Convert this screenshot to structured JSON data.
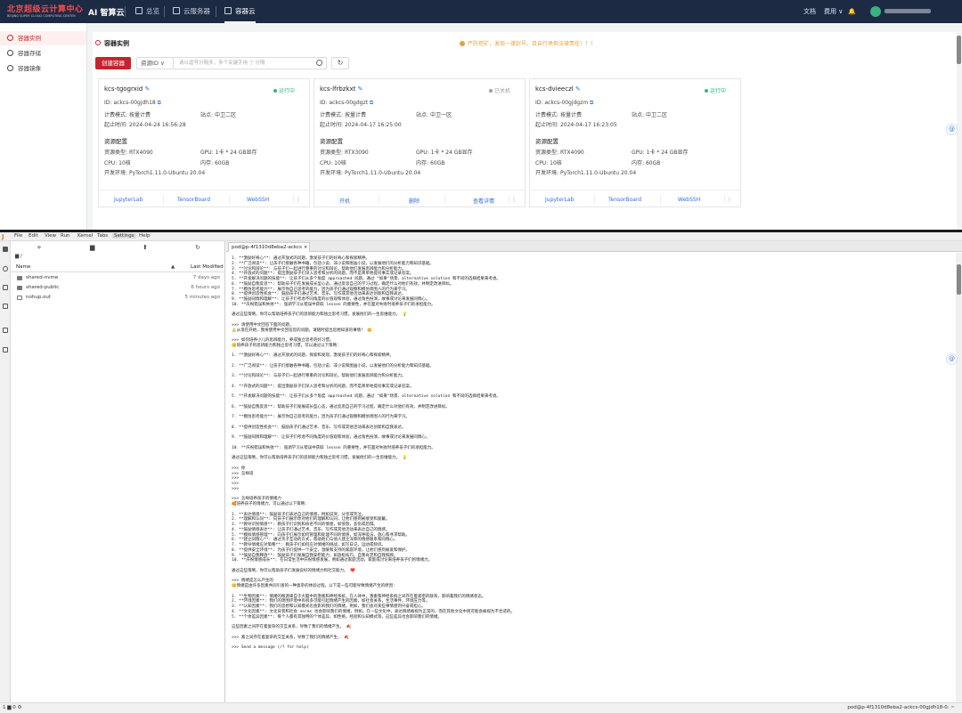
{
  "topbar": {
    "logo_main": "北京超级云计算中心",
    "logo_sub": "BEIJING SUPER CLOUD COMPUTING CENTER",
    "brand": "AI 智算云",
    "nav": [
      {
        "label": "总览",
        "icon": "home-icon"
      },
      {
        "label": "云服务器",
        "icon": "server-icon"
      },
      {
        "label": "容器云",
        "icon": "container-icon"
      }
    ],
    "right": {
      "docs": "文档",
      "billing": "费用",
      "billing_arrow": "∨",
      "bell": "🔔"
    }
  },
  "sidebar": {
    "items": [
      {
        "label": "容器实例",
        "icon": "container-icon"
      },
      {
        "label": "容器存储",
        "icon": "storage-icon"
      },
      {
        "label": "容器镜像",
        "icon": "image-icon"
      }
    ]
  },
  "main": {
    "title": "容器实例",
    "warning": "严防挖矿，发现一律封号，且自行承担法律责任！！！",
    "create_button": "创建容器",
    "select": "资源ID",
    "select_arrow": "∨",
    "search_placeholder": "请以逗号分隔多，多个关键字用 '|' 分隔",
    "refresh": "↻",
    "cards": [
      {
        "name": "kcs-tgogrxid",
        "status": "运行中",
        "status_color": "#36b37e",
        "id_label": "ID:",
        "id": "ackcs-00gjdh18",
        "billing_label": "计费模式:",
        "billing": "按量计费",
        "site_label": "站点:",
        "site": "中卫二区",
        "time_label": "起止时间:",
        "time": "2024-04-24 16:56:28",
        "resource_title": "资源配置",
        "type_label": "资源类型:",
        "type": "RTX4090",
        "gpu_label": "GPU:",
        "gpu": "1卡 * 24 GB显存",
        "cpu_label": "CPU:",
        "cpu": "10核",
        "mem_label": "内存:",
        "mem": "60GB",
        "env_label": "开发环境:",
        "env": "PyTorch1.11.0-Ubuntu 20.04",
        "buttons": [
          "JupyterLab",
          "TensorBoard",
          "WebSSH"
        ],
        "more": "⋮"
      },
      {
        "name": "kcs-lfrbzkxt",
        "status": "已关机",
        "status_color": "#9aa0a6",
        "id_label": "ID:",
        "id": "ackcs-00gdgzt",
        "billing_label": "计费模式:",
        "billing": "按量计费",
        "site_label": "站点:",
        "site": "中卫一区",
        "time_label": "起止时间:",
        "time": "2024-04-17 16:25:00",
        "resource_title": "资源配置",
        "type_label": "资源类型:",
        "type": "RTX3090",
        "gpu_label": "GPU:",
        "gpu": "1卡 * 24 GB显存",
        "cpu_label": "CPU:",
        "cpu": "10核",
        "mem_label": "内存:",
        "mem": "60GB",
        "env_label": "开发环境:",
        "env": "PyTorch1.11.0-Ubuntu 20.04",
        "buttons": [
          "开机",
          "删除",
          "查看详情"
        ],
        "more": "⋮"
      },
      {
        "name": "kcs-dvieeczl",
        "status": "运行中",
        "status_color": "#36b37e",
        "id_label": "ID:",
        "id": "ackcs-00gjdgzm",
        "billing_label": "计费模式:",
        "billing": "按量计费",
        "site_label": "站点:",
        "site": "中卫二区",
        "time_label": "起止时间:",
        "time": "2024-04-17 16:23:05",
        "resource_title": "资源配置",
        "type_label": "资源类型:",
        "type": "RTX4090",
        "gpu_label": "GPU:",
        "gpu": "1卡 * 24 GB显存",
        "cpu_label": "CPU:",
        "cpu": "10核",
        "mem_label": "内存:",
        "mem": "60GB",
        "env_label": "开发环境:",
        "env": "PyTorch1.11.0-Ubuntu 20.04",
        "buttons": [
          "JupyterLab",
          "TensorBoard",
          "WebSSH"
        ],
        "more": "⋮"
      }
    ]
  },
  "jupyter": {
    "menu": [
      "File",
      "Edit",
      "View",
      "Run",
      "Kernel",
      "Tabs",
      "Settings",
      "Help"
    ],
    "filebrowser": {
      "toolbar": [
        "+",
        "▆",
        "⬆",
        "↻"
      ],
      "breadcrumb": "▆ /",
      "col_name": "Name",
      "col_arrow": "▲",
      "col_modified": "Last Modified",
      "rows": [
        {
          "name": "shared-nvme",
          "modified": "7 days ago"
        },
        {
          "name": "shared-public",
          "modified": "6 hours ago"
        },
        {
          "name": "nohup.out",
          "modified": "5 minutes ago"
        }
      ]
    },
    "tab_title": "pod@p-4f1310d8eba2-ackcs ×",
    "terminal_lines": [
      "1. **激励好奇心**: 通过开放式的问题，激发孩子们的好奇心和探索精神。",
      "2. **广泛阅读**: 让孩子们接触各种书籍，包括小说、非小说和图画小说，以发展他们的分析能力和知识基础。",
      "3. **讨论和辩论**: 与孩子们一起进行尊重的讨论和辩论，帮助他们发展思辨能力和分析能力。",
      "4. **开放式的问题**: 提出激励孩子们深入思考和分析的问题，而不是简单地提问事实或记录答案。",
      "5. **开发解决问题的技能**: 让孩子们从多个角度 approached 问题，通过 \"如果\"场景、alternative solution 和不同的选择结果来考虑。",
      "6. **鼓励自我反思**: 帮助孩子们在发展成长型心态，通过反思自己的学习过程，确定什么对他们有效，并制定改进目标。",
      "7. **模仿思考能力**: 展示你自己思考的能力，因为孩子们通过观察和模仿周围人的行为来学习。",
      "8. **提供创造性机会**: 鼓励孩子们通过艺术、音乐、写作或其他活动来表达创新和自我表达。",
      "9. **鼓励同情和理解**: 让孩子们考虑不同角度的价值观和体验，通过角色扮演，故事或讨论来发展同情心。",
      "10. **庆祝错误和失败**: 强调学习从错误中获取 lesson 的重要性，并在面对失败时培养孩子们的承担能力。",
      "",
      "通过这些策略，你可以帮助培养孩子们的思辨能力和独立思考习惯，发展他们的一生思维能力。 💡",
      "",
      ">>> 请使用中文回答下面的问题。",
      "🙏从现在开始，我将使用中文回答您的问题。请随时提出您想知道的事情！ 😊",
      "",
      ">>> 如何培养小儿的思辨能力，养成独立思考的好习惯。",
      "😊培养孩子的思辨能力和独立思考习惯，可以通过以下策略：",
      "",
      "1. **激励好奇心**: 通过开放式的问题，探索和发现，激发孩子们的好奇心和探索精神。",
      "",
      "2. **广泛阅读**: 让孩子们接触各种书籍，包括小说、非小说和图画小说，以发展他们的分析能力和知识基础。",
      "",
      "3. **讨论和辩论**: 与孩子们一起进行尊重的讨论和辩论，帮助他们发展思辨能力和分析能力。",
      "",
      "4. **开放式的问题**: 提出激励孩子们深入思考和分析的问题，而不是简单地提问事实或记录答案。",
      "",
      "5. **开发解决问题的技能**: 让孩子们从多个角度 approached 问题，通过 \"如果\"场景、alternative solution 和不同的选择结果来考虑。",
      "",
      "6. **鼓励自我反思**: 帮助孩子们发展成长型心态，通过反思自己的学习过程，确定什么对他们有效，并制定改进目标。",
      "",
      "7. **模仿思考能力**: 展示你自己思考的能力，因为孩子们通过观察和模仿周围人的行为来学习。",
      "",
      "8. **提供创造性机会**: 鼓励孩子们通过艺术、音乐、写作或其他活动来表达创新和自我表达。",
      "",
      "9. **鼓励同情和理解**: 让孩子们考虑不同角度的价值观和体验，通过角色扮演，故事或讨论来发展同情心。",
      "",
      "10. **庆祝错误和失败**: 强调学习从错误中获取 lesson 的重要性，并在面对失败时培养孩子们的承担能力。",
      "",
      "通过这些策略，你可以帮助培养孩子们的思辨能力和独立思考习惯，发展他们的一生思维能力。 💡",
      "",
      ">>> 你",
      ">>> 怎样培",
      ">>>",
      ">>>",
      ">>>",
      "",
      ">>> 怎样培养孩子的情绪力",
      "🥰培养孩子的情绪力，可以通过以下策略：",
      "",
      "1. **表达情感**: 鼓励孩子们表达自己的情感，例如说哭，分享或笑泣。",
      "2. **理解和认同**: 向孩子们展示你对他们的理解和认同，让他们感到被接受和爱戴。",
      "3. **教导识别情感**: 教孩子们识别和命名不同的情感，如愤怒，悲伤或恐惧。",
      "4. **鼓励情感表达**: 让孩子们通过艺术、音乐、写作或其他活动来表达自己的情感。",
      "5. **模拟情感管理**: 向孩子们展示如何管理和处理不同的情感，如深呼吸法，放心和寻求帮助。",
      "6. **建立同情心**: 通过亲子互动的方式，帮助他们与他人建立深厚的情感联系和同情心。",
      "7. **教导情绪应对策略**: 教孩子们如何应对情绪的挑战，如写日记，运动或倾诉。",
      "8. **提供安全环境**: 为孩子们提供一个安全，温暖和支持的家庭环境，让他们感到被爱和保护。",
      "9. **鼓励自我释放**: 鼓励孩子们发展自我安慰能力，如放松技巧，自我肯定和自我照顾。",
      "10. **庆祝情感成长**: 在日常生活中庆祝情感发展，例如通过家庭活动，家庭或讨论来培养孩子们的情绪力。",
      "",
      "通过这些策略，你可以帮助孩子们发展良好的情绪力和社交能力。 ❤️",
      "",
      ">>> 情绪是怎么产生的",
      "😊情绪是由许多因素共同引发的一种复杂的体验过程。以下是一些可能导致情绪产生的原因：",
      "",
      "1. **生物因素**: 情绪的根源来自于大脑中的激素和神经系统，在人体中，激素和神经系统之间存在着紧密的联系，影响着我们的情绪状态。",
      "2. **环境因素**: 我们的周围环境中有很多可能引起情绪产生的因素，如社会关系，生活事件，环境压力等。",
      "3. **认知因素**: 我们的思想和认知模式也会影响我们的情绪，例如，我们会对某些事情感到兴奋或担心。",
      "4. **文化因素**: 文化背景和社会 norms 也会影响我们的情绪，例如，在一些文化中，表达情感被视为正常的，而在其他文化中则可能会被视为不合适的。",
      "5. **个体差异因素**: 每个人都有其独特的个体差异，如性格，经验和认知模式等，这些差异也会影响我们的情绪。",
      "",
      "这些因素之间存在着复杂的交互关系，导致了我们的情绪产生。 🍂",
      "",
      ">>> 素之间存在着复杂的交互关系，导致了我们的情绪产生。 🍂",
      "",
      ">>> Send a message (/? for help)"
    ],
    "status_left": "1 ▆ 0 ⚙",
    "status_right": "pod@p-4f1310d8eba2-ackcs-00gjdh18-0: ~"
  },
  "float_icon": "@"
}
